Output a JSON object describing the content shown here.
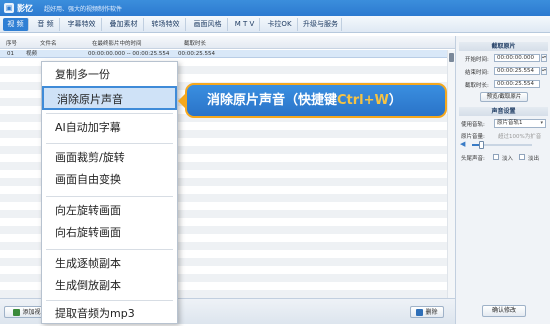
{
  "app": {
    "name": "影忆",
    "slogan": "超好用、强大的视频制作软件"
  },
  "menu": [
    {
      "label": "视 频",
      "active": true
    },
    {
      "label": "音 频",
      "active": false
    },
    {
      "label": "字幕特效",
      "active": false
    },
    {
      "label": "叠加素材",
      "active": false
    },
    {
      "label": "转场特效",
      "active": false
    },
    {
      "label": "画面风格",
      "active": false
    },
    {
      "label": "M T V",
      "active": false
    },
    {
      "label": "卡拉OK",
      "active": false
    },
    {
      "label": "升级与服务",
      "active": false
    }
  ],
  "table": {
    "columns": [
      "序号",
      "文件名",
      "在最终影片中的时间",
      "截取时长"
    ],
    "rows": [
      {
        "index": "01",
        "name": "视频",
        "time": "00:00:00.000 -- 00:00:25.554",
        "duration": "00:00:25.554"
      }
    ]
  },
  "bottom": {
    "add_label": "添加视",
    "delete_label": "删除"
  },
  "right_panel": {
    "clip_title": "截取原片",
    "start_label": "开始时间:",
    "start_value": "00:00:00.000",
    "end_label": "结束时间:",
    "end_value": "00:00:25.554",
    "duration_label": "截取时长:",
    "duration_value": "00:00:25.554",
    "preview_button": "预览/截取原片",
    "audio_title": "声音设置",
    "track_label": "使用音轨:",
    "track_value": "原片音轨1",
    "volume_label": "原片音量:",
    "volume_hint": "超过100%为扩音",
    "volume_level": 0.15,
    "fade_label": "头尾声音:",
    "fade_in": "淡入",
    "fade_out": "淡出",
    "confirm_button": "确认修改"
  },
  "context_menu": [
    {
      "label": "复制多一份",
      "highlight": false
    },
    {
      "label": "消除原片声音",
      "highlight": true
    },
    {
      "label": "AI自动加字幕",
      "highlight": false
    },
    {
      "label": "画面裁剪/旋转",
      "highlight": false
    },
    {
      "label": "画面自由变换",
      "highlight": false
    },
    {
      "label": "向左旋转画面",
      "highlight": false
    },
    {
      "label": "向右旋转画面",
      "highlight": false
    },
    {
      "label": "生成逐帧副本",
      "highlight": false
    },
    {
      "label": "生成倒放副本",
      "highlight": false
    },
    {
      "label": "提取音频为mp3",
      "highlight": false
    }
  ],
  "callout": {
    "text": "消除原片声音（快捷键",
    "hotkey": "Ctrl+W",
    "close": "）"
  },
  "colors": {
    "accent": "#2f7fd4",
    "callout_border": "#f6a81d",
    "hotkey": "#f6c343"
  }
}
